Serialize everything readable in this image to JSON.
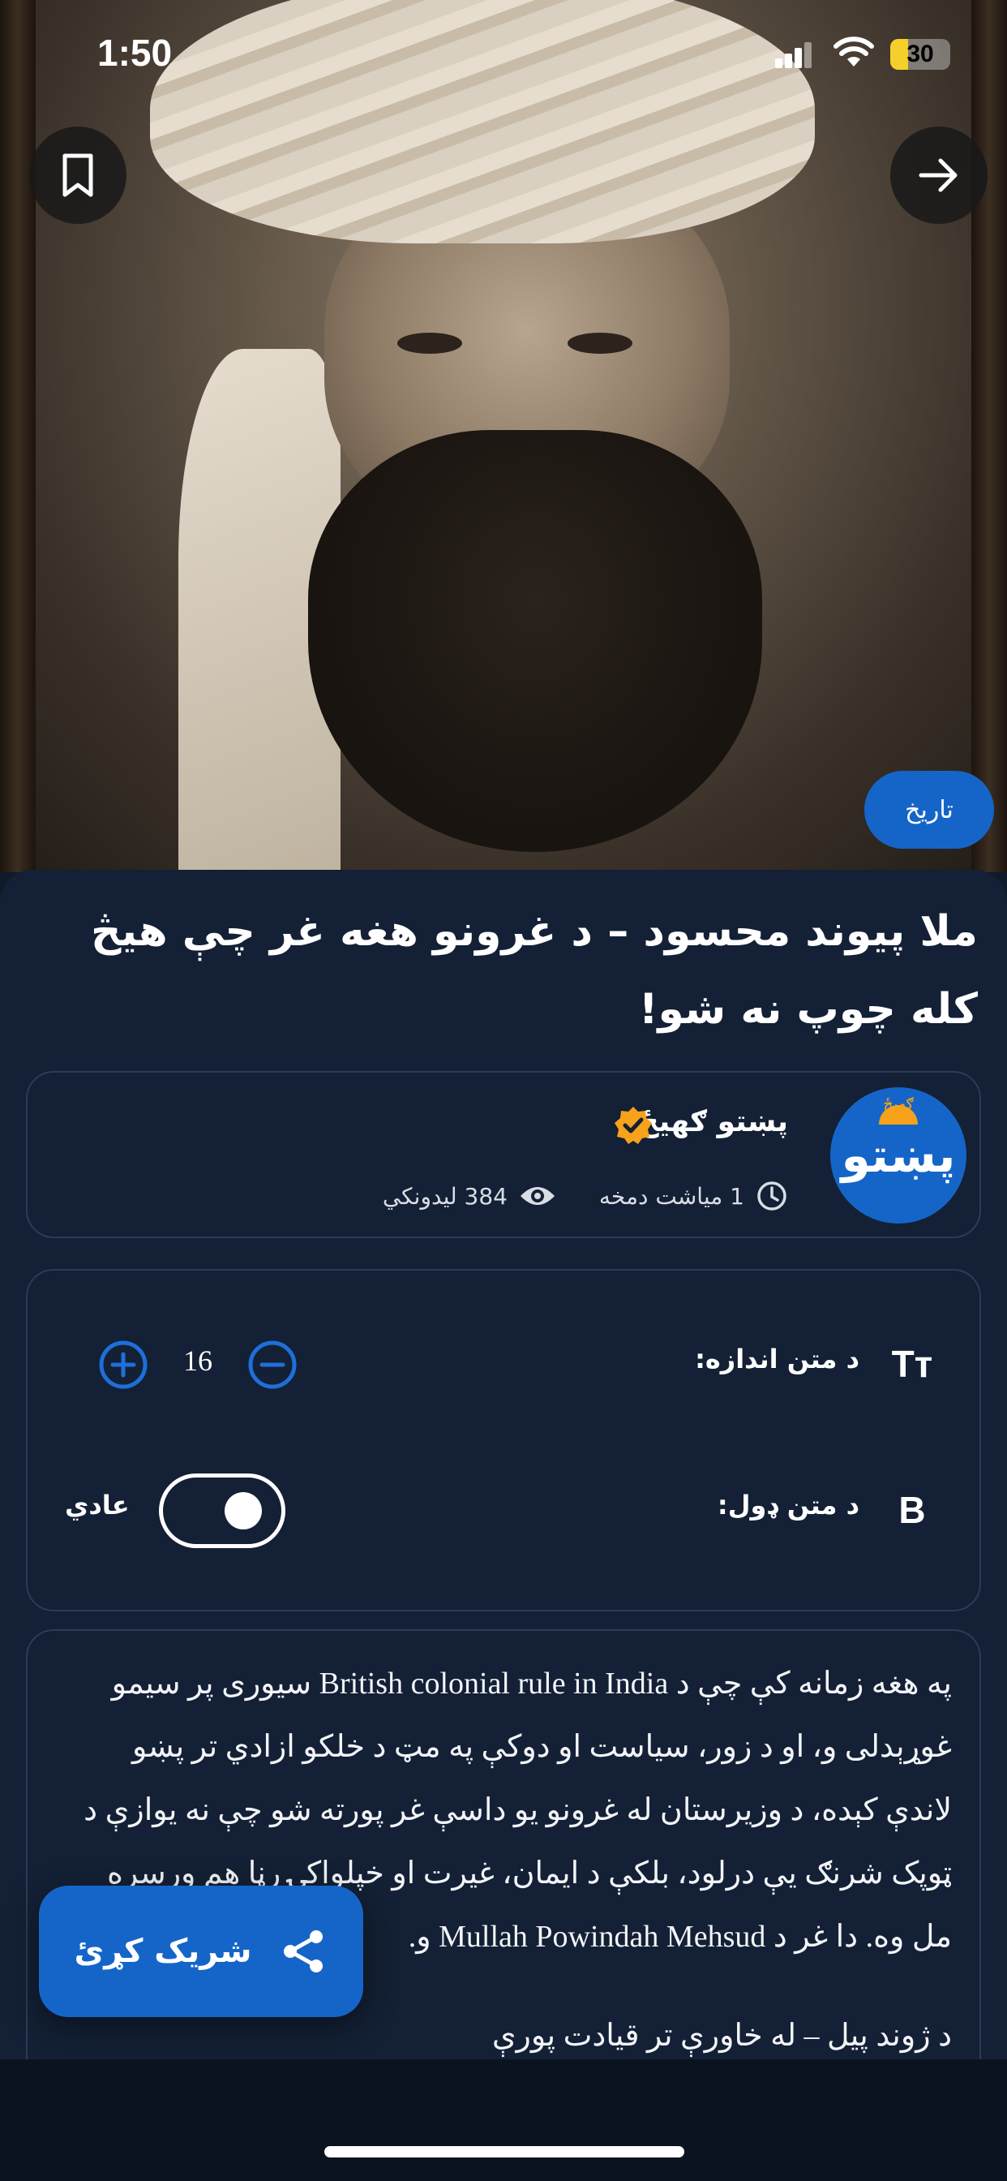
{
  "status_bar": {
    "time": "1:50",
    "battery": "30",
    "battery_level": 0.3
  },
  "hero": {
    "category": "تاریخ",
    "photo_description": "sepia portrait of a man with a white turban and dark beard"
  },
  "article": {
    "title": "ملا پیوند محسود – د غرونو هغه غر چې هیڅ کله چوپ نه شو!"
  },
  "author": {
    "name": "پښتو ګهیځ",
    "logo_text": "پښتو",
    "logo_small": "ګهیځ",
    "time_ago": "1 میاشت دمخه",
    "views": "384 لیدونکي",
    "verified_color": "#f7a21b"
  },
  "settings": {
    "font_size_label": "د متن اندازه:",
    "font_size_icon_text": "Tт",
    "font_size_value": "16",
    "font_weight_label": "د متن ډول:",
    "font_weight_icon_text": "B",
    "font_weight_value": "عادي"
  },
  "body": {
    "paragraph_1": "په هغه زمانه کې چې د British colonial rule in India سیوری پر سیمو غوړېدلی و، او د زور، سیاست او دوکې په مټ د خلکو ازادي تر پښو لاندې کېده، د وزیرستان له غرونو یو داسې غر پورته شو چې نه یوازې د ټوپک شرنګ یې درلود، بلکې د ایمان، غیرت او خپلواکۍ رڼا هم ورسره مل وه. دا غر د Mullah Powindah Mehsud و.",
    "paragraph_2": "د ژوند پیل – له خاورې تر قیادت پورې"
  },
  "share": {
    "label": "شریک کړئ"
  },
  "colors": {
    "accent": "#1565c8",
    "sheet": "#132035",
    "card_border": "#2c3c55"
  }
}
